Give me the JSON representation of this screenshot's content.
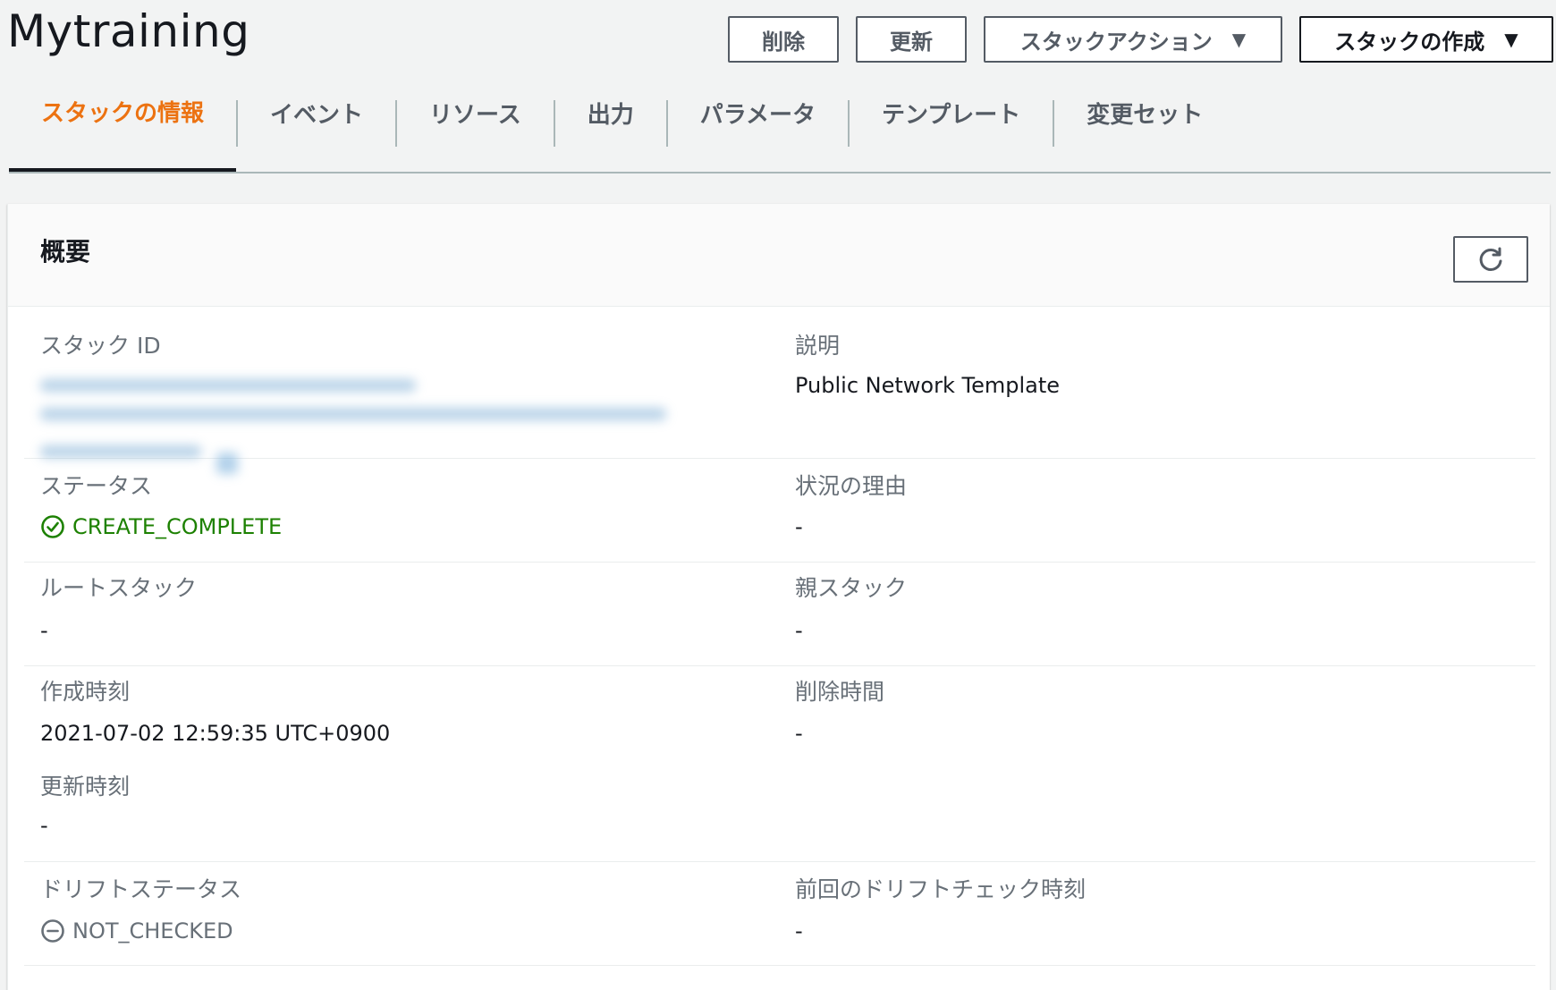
{
  "header": {
    "title": "Mytraining",
    "buttons": {
      "delete": "削除",
      "update": "更新",
      "stack_actions": "スタックアクション",
      "create_stack": "スタックの作成"
    }
  },
  "tabs": [
    {
      "label": "スタックの情報",
      "active": true
    },
    {
      "label": "イベント"
    },
    {
      "label": "リソース"
    },
    {
      "label": "出力"
    },
    {
      "label": "パラメータ"
    },
    {
      "label": "テンプレート"
    },
    {
      "label": "変更セット"
    }
  ],
  "overview": {
    "title": "概要",
    "stack_id": {
      "label": "スタック ID"
    },
    "description": {
      "label": "説明",
      "value": "Public Network Template"
    },
    "status": {
      "label": "ステータス",
      "value": "CREATE_COMPLETE"
    },
    "status_reason": {
      "label": "状況の理由",
      "value": "-"
    },
    "root_stack": {
      "label": "ルートスタック",
      "value": "-"
    },
    "parent_stack": {
      "label": "親スタック",
      "value": "-"
    },
    "created_time": {
      "label": "作成時刻",
      "value": "2021-07-02 12:59:35 UTC+0900"
    },
    "deleted_time": {
      "label": "削除時間",
      "value": "-"
    },
    "updated_time": {
      "label": "更新時刻",
      "value": "-"
    },
    "drift_status": {
      "label": "ドリフトステータス",
      "value": "NOT_CHECKED"
    },
    "last_drift_check": {
      "label": "前回のドリフトチェック時刻",
      "value": "-"
    }
  },
  "colors": {
    "accent_active_tab": "#ec7211",
    "status_success": "#1d8102",
    "status_neutral": "#687078",
    "link": "#0073bb"
  },
  "icons": {
    "refresh": "refresh-icon",
    "status_success": "check-circle-icon",
    "status_neutral": "minus-circle-icon",
    "dropdown": "caret-down-icon",
    "copy": "copy-icon"
  }
}
